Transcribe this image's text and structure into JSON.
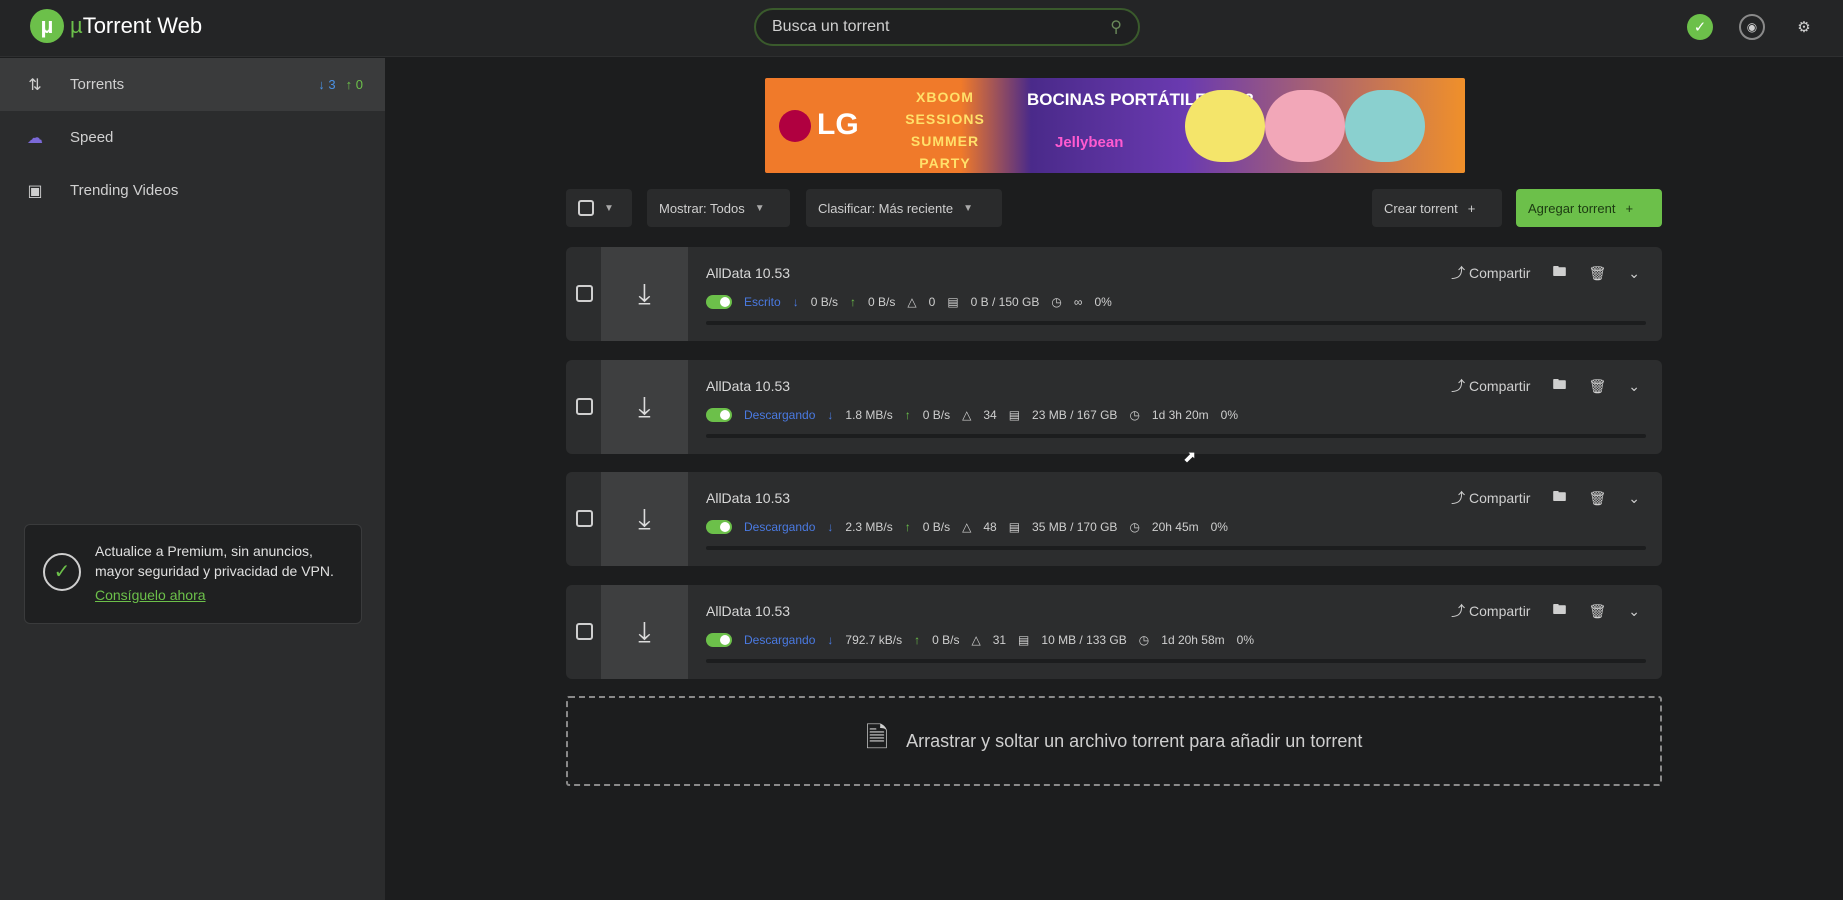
{
  "app": {
    "logo_mark": "µ",
    "name_mu": "µ",
    "name_rest": "Torrent Web"
  },
  "search": {
    "placeholder": "Busca un torrent",
    "icon": "search-icon"
  },
  "top_icons": [
    "check-icon",
    "vpn-shield-icon",
    "settings-gear-icon"
  ],
  "sidebar": {
    "items": [
      {
        "label": "Torrents",
        "icon": "torrents-icon",
        "down_count": "3",
        "up_count": "0"
      },
      {
        "label": "Speed",
        "icon": "speed-cloud-icon"
      },
      {
        "label": "Trending Videos",
        "icon": "trending-videos-icon"
      }
    ],
    "premium": {
      "text": "Actualice a Premium, sin anuncios, mayor seguridad y privacidad de VPN.",
      "link": "Consíguelo ahora"
    }
  },
  "ad": {
    "brand": "LG",
    "series": "XBOOM SESSIONS",
    "event": "SUMMER PARTY",
    "headline": "BOCINAS PORTÁTILES PL2",
    "tagline": "Jellybean"
  },
  "toolbar": {
    "show_label": "Mostrar: Todos",
    "sort_label": "Clasificar: Más reciente",
    "create_label": "Crear torrent",
    "add_label": "Agregar torrent"
  },
  "torrents": [
    {
      "name": "AllData 10.53",
      "status": "Escrito",
      "down": "0 B/s",
      "up": "0 B/s",
      "peers": "0",
      "size": "0 B / 150 GB",
      "eta": "∞",
      "percent": "0%"
    },
    {
      "name": "AllData 10.53",
      "status": "Descargando",
      "down": "1.8 MB/s",
      "up": "0 B/s",
      "peers": "34",
      "size": "23 MB / 167 GB",
      "eta": "1d 3h 20m",
      "percent": "0%"
    },
    {
      "name": "AllData 10.53",
      "status": "Descargando",
      "down": "2.3 MB/s",
      "up": "0 B/s",
      "peers": "48",
      "size": "35 MB / 170 GB",
      "eta": "20h 45m",
      "percent": "0%"
    },
    {
      "name": "AllData 10.53",
      "status": "Descargando",
      "down": "792.7 kB/s",
      "up": "0 B/s",
      "peers": "31",
      "size": "10 MB / 133 GB",
      "eta": "1d 20h 58m",
      "percent": "0%"
    }
  ],
  "row_actions": {
    "share": "Compartir"
  },
  "drop_zone": {
    "text": "Arrastrar y soltar un archivo torrent para añadir un torrent"
  }
}
